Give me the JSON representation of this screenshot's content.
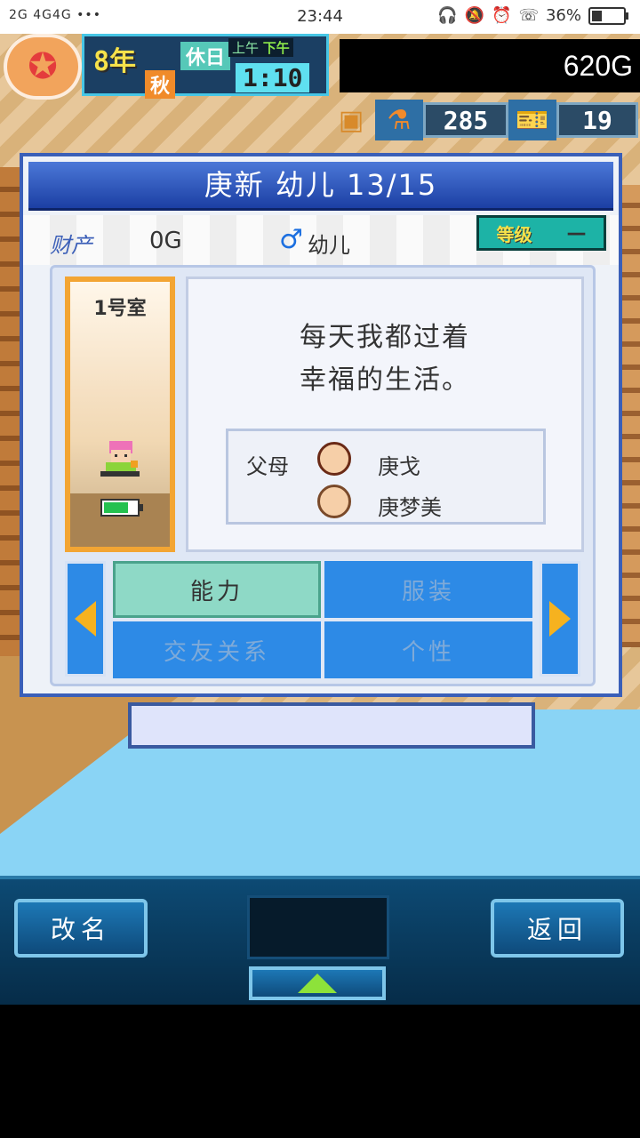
{
  "status_bar": {
    "signal_text": "2G 4G4G",
    "more": "•••",
    "time": "23:44",
    "icons": [
      "headset-icon",
      "bell-off-icon",
      "alarm-icon",
      "hd-call-icon"
    ],
    "battery_percent": "36%",
    "battery_level": 0.36
  },
  "hud": {
    "year": "8年",
    "holiday": "休日",
    "season": "秋",
    "am_label": "上午",
    "pm_label": "下午",
    "time": "1:10",
    "money": "620G",
    "research_points": "285",
    "tickets": "19",
    "icons": [
      "treasure-chest-icon",
      "flask-icon",
      "ticket-icon"
    ]
  },
  "dialog": {
    "title": "庚新 幼儿 13/15",
    "property_label": "财产",
    "property_value": "0G",
    "gender_symbol": "♂",
    "stage": "幼儿",
    "level_label": "等级",
    "level_value": "—",
    "room_label": "1号室",
    "energy_level": 0.75,
    "message_line1": "每天我都过着",
    "message_line2": "幸福的生活。",
    "parents_label": "父母",
    "father_name": "庚戈",
    "mother_name": "庚梦美",
    "tabs": {
      "ability": "能力",
      "clothing": "服装",
      "friends": "交友关系",
      "personality": "个性"
    }
  },
  "bottom": {
    "rename": "改名",
    "back": "返回"
  },
  "colors": {
    "dialog_blue": "#3a5fb8",
    "tab_active": "#8ed9c6",
    "tab_inactive": "#2d8ae6",
    "arrow": "#f6b21f"
  }
}
